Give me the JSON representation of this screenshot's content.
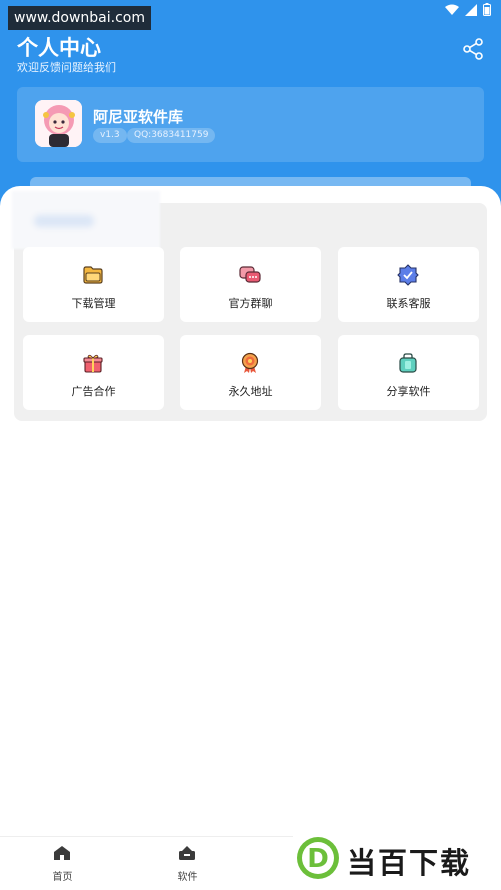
{
  "watermark": {
    "url": "www.downbai.com"
  },
  "header": {
    "title": "个人中心",
    "subtitle": "欢迎反馈问题给我们",
    "share_icon": "share-icon"
  },
  "app_card": {
    "name": "阿尼亚软件库",
    "version": "v1.3",
    "qq": "QQ:3683411759"
  },
  "menu": {
    "items": [
      {
        "label": "下载管理",
        "icon": "folder-icon"
      },
      {
        "label": "官方群聊",
        "icon": "chat-icon"
      },
      {
        "label": "联系客服",
        "icon": "support-badge-icon"
      },
      {
        "label": "广告合作",
        "icon": "gift-icon"
      },
      {
        "label": "永久地址",
        "icon": "medal-icon"
      },
      {
        "label": "分享软件",
        "icon": "bag-icon"
      }
    ]
  },
  "tabbar": {
    "items": [
      {
        "label": "首页",
        "icon": "home-icon"
      },
      {
        "label": "软件",
        "icon": "apps-icon"
      }
    ]
  },
  "brand": {
    "logo_text": "当百下载",
    "logo_letter": "D"
  },
  "colors": {
    "primary": "#2f93ec",
    "panel": "#f0f0f0",
    "brand_green": "#6cbf3a"
  }
}
